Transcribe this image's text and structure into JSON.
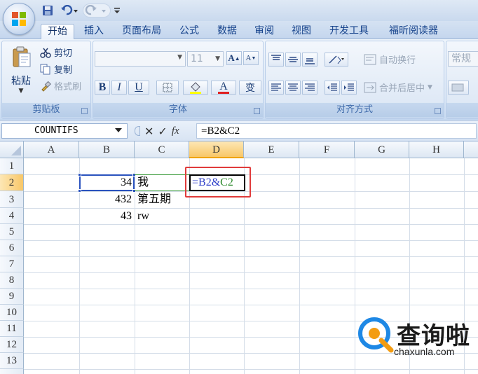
{
  "tabs": [
    {
      "label": "开始",
      "active": true
    },
    {
      "label": "插入"
    },
    {
      "label": "页面布局"
    },
    {
      "label": "公式"
    },
    {
      "label": "数据"
    },
    {
      "label": "审阅"
    },
    {
      "label": "视图"
    },
    {
      "label": "开发工具"
    },
    {
      "label": "福昕阅读器"
    }
  ],
  "ribbon": {
    "clipboard": {
      "label": "剪贴板",
      "paste": "粘贴",
      "cut": "剪切",
      "copy": "复制",
      "format_painter": "格式刷"
    },
    "font": {
      "label": "字体",
      "font_name": "",
      "font_size": "11",
      "bold": "B",
      "italic": "I",
      "underline": "U",
      "grow": "A",
      "shrink": "A",
      "font_color": "A",
      "phonetic": "变"
    },
    "alignment": {
      "label": "对齐方式",
      "wrap_text": "自动换行",
      "merge_center": "合并后居中"
    },
    "number": {
      "format": "常规"
    }
  },
  "formula_bar": {
    "name_box": "COUNTIFS",
    "cancel": "✕",
    "enter": "✓",
    "fx": "fx",
    "formula": "=B2&C2"
  },
  "grid": {
    "columns": [
      "A",
      "B",
      "C",
      "D",
      "E",
      "F",
      "G",
      "H"
    ],
    "rows": [
      "1",
      "2",
      "3",
      "4",
      "5",
      "6",
      "7",
      "8",
      "9",
      "10",
      "11",
      "12",
      "13"
    ],
    "active_column": "D",
    "active_row": "2",
    "cells": {
      "B2": "34",
      "C2": "我",
      "B3": "432",
      "C3": "第五期",
      "B4": "43",
      "C4": "rw"
    },
    "edit_cell": {
      "ref": "D2",
      "prefix": "=B2&",
      "ref2": "C2"
    }
  },
  "watermark": {
    "title": "查询啦",
    "url": "chaxunla.com"
  },
  "colors": {
    "selection": "#2a52be",
    "reference": "#2c8a2c",
    "highlight": "#e03b3b",
    "header_active": "#f8c768"
  }
}
